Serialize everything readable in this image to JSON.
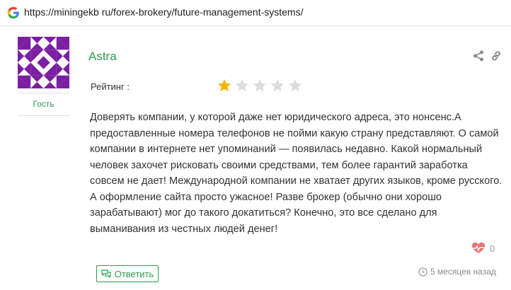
{
  "browser": {
    "url": "https://miningekb ru/forex-brokery/future-management-systems/"
  },
  "comment": {
    "author": "Astra",
    "role": "Гость",
    "rating_label": "Рейтинг :",
    "rating": 1,
    "rating_max": 5,
    "text": "Доверять компании, у которой даже нет юридического адреса, это нонсенс.А предоставленные номера телефонов не пойми какую страну представляют. О самой компании в интернете нет упоминаний — появилась недавно. Какой нормальный человек захочет рисковать своими средствами, тем более гарантий заработка совсем не дает! Международной компании не хватает других языков, кроме русского. А оформление сайта просто ужасное! Разве брокер (обычно они хорошо зарабатывают) мог до такого докатиться? Конечно, это все сделано для выманивания из честных людей денег!",
    "likes": "0",
    "reply_label": "Ответить",
    "time": "5 месяцев назад"
  },
  "icons": {
    "browser_icon": "google-icon",
    "share": "share-icon",
    "link": "link-icon",
    "like": "heart-pulse-icon",
    "reply": "chat-bubbles-icon",
    "time": "clock-icon"
  },
  "colors": {
    "accent": "#2e9b4f",
    "avatar": "#7b1fa2",
    "star_filled": "#f5b301",
    "star_empty": "#dddddd",
    "like": "#e57373"
  }
}
